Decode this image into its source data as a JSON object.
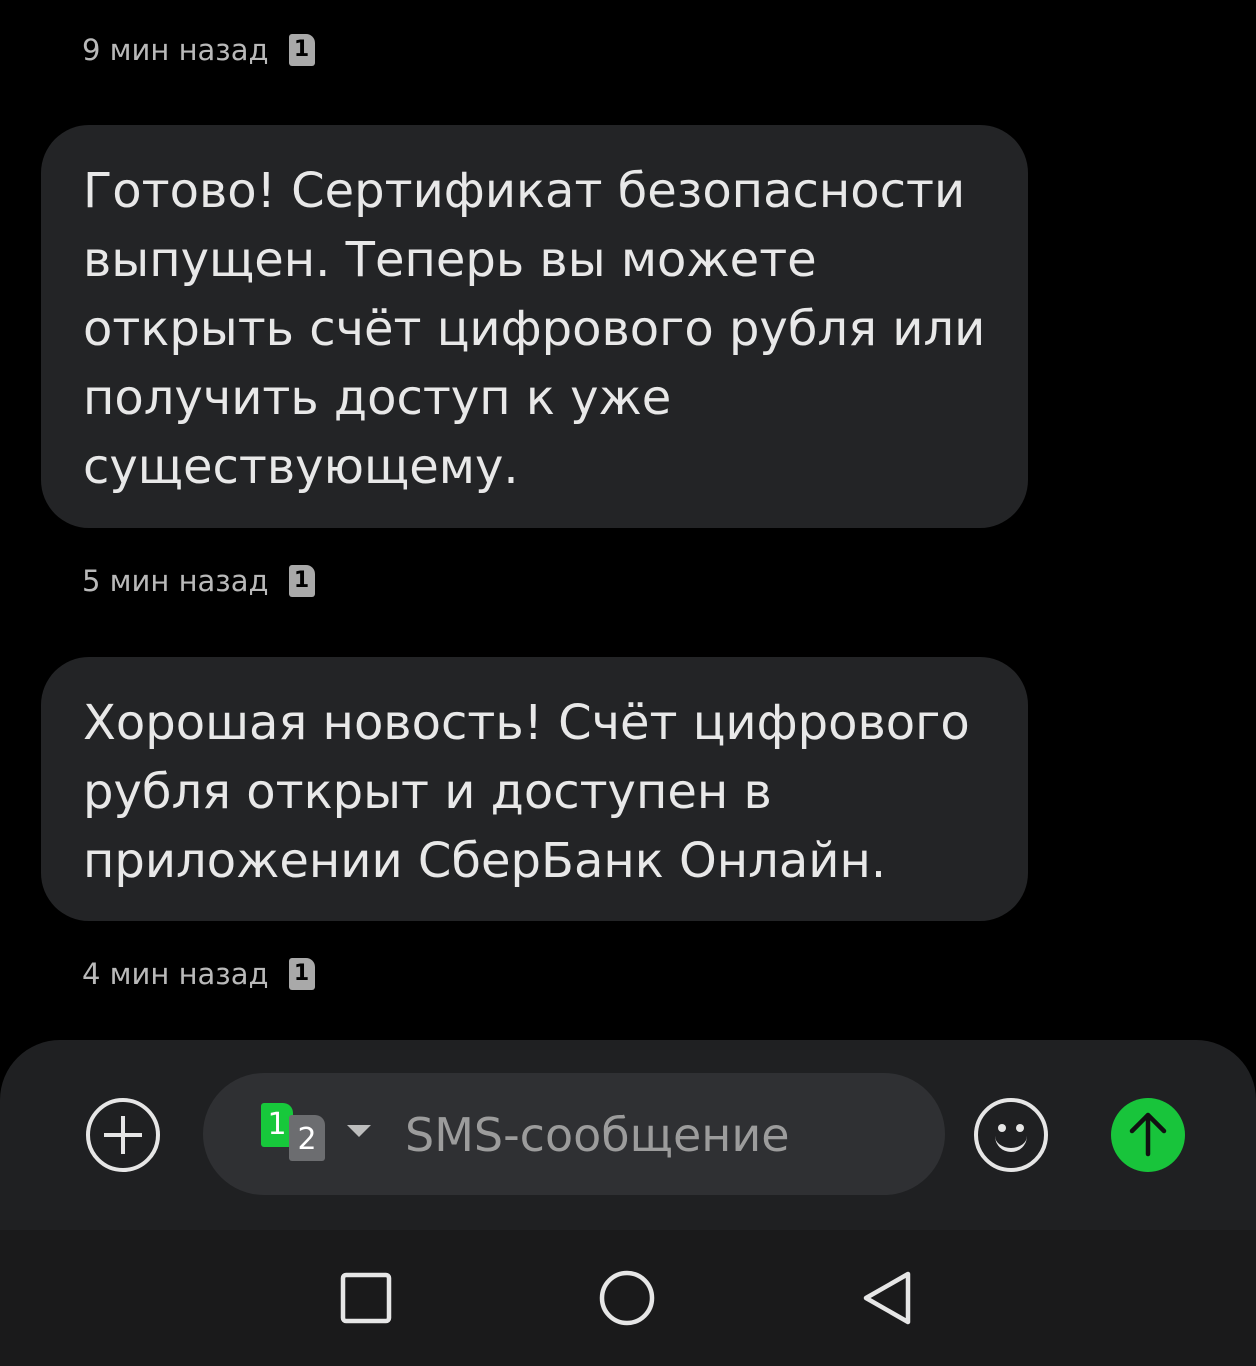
{
  "messages": [
    {
      "text": "Готово! Сертификат безопасности выпущен. Теперь вы можете открыть счёт цифрового рубля или получить доступ к уже существующему.",
      "time": "5 мин назад",
      "sim": "1"
    },
    {
      "text": "Хорошая новость! Счёт цифрового рубля открыт и доступен в приложении СберБанк Онлайн.",
      "time": "4 мин назад",
      "sim": "1"
    }
  ],
  "previous_timestamp": {
    "time": "9 мин назад",
    "sim": "1"
  },
  "composer": {
    "sim_primary": "1",
    "sim_secondary": "2",
    "placeholder": "SMS-сообщение"
  },
  "colors": {
    "background": "#000000",
    "bubble": "#232426",
    "send_button": "#18c43b",
    "sim1_badge": "#17c83b"
  },
  "icons": {
    "add": "plus-circle-icon",
    "emoji": "smiley-icon",
    "send": "arrow-up-icon",
    "nav_recent": "square-icon",
    "nav_home": "circle-icon",
    "nav_back": "triangle-back-icon"
  }
}
